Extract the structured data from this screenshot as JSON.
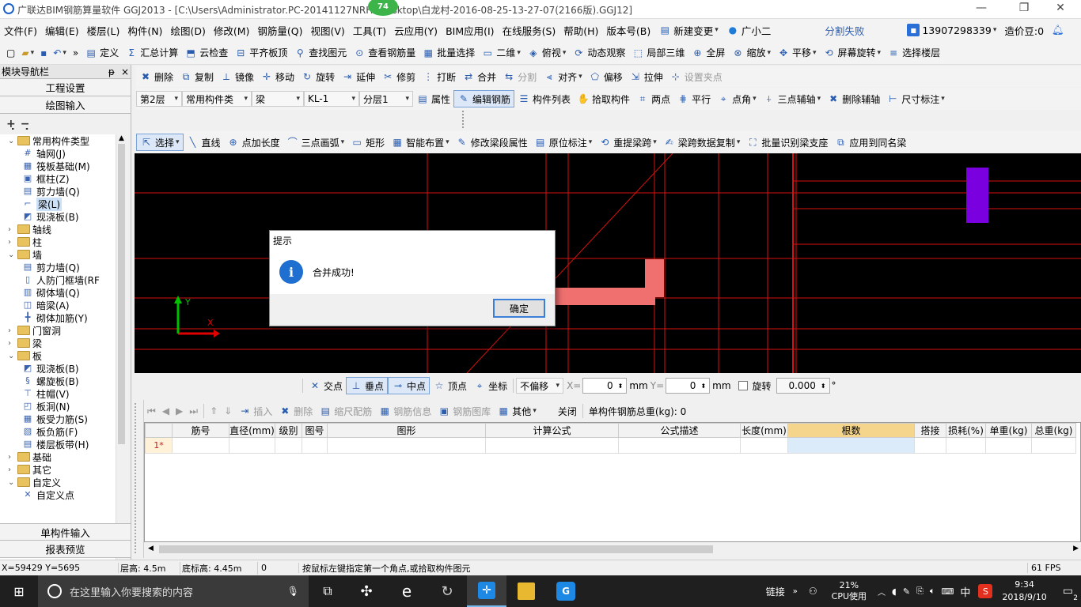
{
  "window": {
    "title": "广联达BIM钢筋算量软件 GGJ2013 - [C:\\Users\\Administrator.PC-20141127NRHI\\Desktop\\白龙村-2016-08-25-13-27-07(2166版).GGJ12]",
    "badge": "74",
    "minimize": "—",
    "restore": "❐",
    "close": "✕"
  },
  "menu": {
    "items": [
      "文件(F)",
      "编辑(E)",
      "楼层(L)",
      "构件(N)",
      "绘图(D)",
      "修改(M)",
      "钢筋量(Q)",
      "视图(V)",
      "工具(T)",
      "云应用(Y)",
      "BIM应用(I)",
      "在线服务(S)",
      "帮助(H)",
      "版本号(B)"
    ],
    "new_change": "新建变更",
    "assistant": "广小二",
    "split_status": "分割失败",
    "phone": "13907298339",
    "price": "造价豆:0"
  },
  "toolbar1": {
    "items": [
      "定义",
      "汇总计算",
      "云检查",
      "平齐板顶",
      "查找图元",
      "查看钢筋量",
      "批量选择",
      "二维",
      "俯视",
      "动态观察",
      "局部三维",
      "全屏",
      "缩放",
      "平移",
      "屏幕旋转",
      "选择楼层"
    ]
  },
  "toolbar2": {
    "items": [
      "删除",
      "复制",
      "镜像",
      "移动",
      "旋转",
      "延伸",
      "修剪",
      "打断",
      "合并",
      "分割",
      "对齐",
      "偏移",
      "拉伸",
      "设置夹点"
    ]
  },
  "toolbar3": {
    "floor": "第2层",
    "category": "常用构件类",
    "type": "梁",
    "name": "KL-1",
    "layer": "分层1",
    "items": [
      "属性",
      "编辑钢筋",
      "构件列表",
      "拾取构件",
      "两点",
      "平行",
      "点角",
      "三点辅轴",
      "删除辅轴",
      "尺寸标注"
    ]
  },
  "toolbar4": {
    "items": [
      "选择",
      "直线",
      "点加长度",
      "三点画弧",
      "矩形",
      "智能布置",
      "修改梁段属性",
      "原位标注",
      "重提梁跨",
      "梁跨数据复制",
      "批量识别梁支座",
      "应用到同名梁"
    ]
  },
  "nav": {
    "title": "模块导航栏",
    "pin": "ᵽ",
    "close": "×",
    "sections": [
      "工程设置",
      "绘图输入"
    ],
    "bottom_sections": [
      "单构件输入",
      "报表预览"
    ],
    "tree": [
      {
        "label": "常用构件类型",
        "level": 0,
        "kind": "folder",
        "exp": "⌄"
      },
      {
        "label": "轴网(J)",
        "level": 1,
        "kind": "comp",
        "icon": "#"
      },
      {
        "label": "筏板基础(M)",
        "level": 1,
        "kind": "comp",
        "icon": "▦"
      },
      {
        "label": "框柱(Z)",
        "level": 1,
        "kind": "comp",
        "icon": "▣"
      },
      {
        "label": "剪力墙(Q)",
        "level": 1,
        "kind": "comp",
        "icon": "▤"
      },
      {
        "label": "梁(L)",
        "level": 1,
        "kind": "comp",
        "icon": "⌐",
        "selected": true
      },
      {
        "label": "现浇板(B)",
        "level": 1,
        "kind": "comp",
        "icon": "◩"
      },
      {
        "label": "轴线",
        "level": 0,
        "kind": "folder",
        "exp": "›"
      },
      {
        "label": "柱",
        "level": 0,
        "kind": "folder",
        "exp": "›"
      },
      {
        "label": "墙",
        "level": 0,
        "kind": "folder",
        "exp": "⌄"
      },
      {
        "label": "剪力墙(Q)",
        "level": 1,
        "kind": "comp",
        "icon": "▤"
      },
      {
        "label": "人防门框墙(RF",
        "level": 1,
        "kind": "comp",
        "icon": "▯"
      },
      {
        "label": "砌体墙(Q)",
        "level": 1,
        "kind": "comp",
        "icon": "▥"
      },
      {
        "label": "暗梁(A)",
        "level": 1,
        "kind": "comp",
        "icon": "◫"
      },
      {
        "label": "砌体加筋(Y)",
        "level": 1,
        "kind": "comp",
        "icon": "╋"
      },
      {
        "label": "门窗洞",
        "level": 0,
        "kind": "folder",
        "exp": "›"
      },
      {
        "label": "梁",
        "level": 0,
        "kind": "folder",
        "exp": "›"
      },
      {
        "label": "板",
        "level": 0,
        "kind": "folder",
        "exp": "⌄"
      },
      {
        "label": "现浇板(B)",
        "level": 1,
        "kind": "comp",
        "icon": "◩"
      },
      {
        "label": "螺旋板(B)",
        "level": 1,
        "kind": "comp",
        "icon": "§"
      },
      {
        "label": "柱帽(V)",
        "level": 1,
        "kind": "comp",
        "icon": "⊤"
      },
      {
        "label": "板洞(N)",
        "level": 1,
        "kind": "comp",
        "icon": "◰"
      },
      {
        "label": "板受力筋(S)",
        "level": 1,
        "kind": "comp",
        "icon": "▦"
      },
      {
        "label": "板负筋(F)",
        "level": 1,
        "kind": "comp",
        "icon": "▧"
      },
      {
        "label": "楼层板带(H)",
        "level": 1,
        "kind": "comp",
        "icon": "▤"
      },
      {
        "label": "基础",
        "level": 0,
        "kind": "folder",
        "exp": "›"
      },
      {
        "label": "其它",
        "level": 0,
        "kind": "folder",
        "exp": "›"
      },
      {
        "label": "自定义",
        "level": 0,
        "kind": "folder",
        "exp": "⌄"
      },
      {
        "label": "自定义点",
        "level": 1,
        "kind": "comp",
        "icon": "✕"
      }
    ]
  },
  "dialog": {
    "title": "提示",
    "message": "合并成功!",
    "ok": "确定"
  },
  "snapbar": {
    "items": [
      "交点",
      "垂点",
      "中点",
      "顶点",
      "坐标"
    ],
    "offset": "不偏移",
    "x_label": "X=",
    "x_value": "0",
    "x_unit": "mm",
    "y_label": "Y=",
    "y_value": "0",
    "y_unit": "mm",
    "rotate_label": "旋转",
    "rotate_value": "0.000",
    "degree": "°"
  },
  "grid_toolbar": {
    "items": [
      "插入",
      "删除",
      "缩尺配筋",
      "钢筋信息",
      "钢筋图库",
      "其他",
      "关闭"
    ],
    "total": "单构件钢筋总重(kg): 0"
  },
  "grid": {
    "columns": [
      "筋号",
      "直径(mm)",
      "级别",
      "图号",
      "图形",
      "计算公式",
      "公式描述",
      "长度(mm)",
      "根数",
      "搭接",
      "损耗(%)",
      "单重(kg)",
      "总重(kg)"
    ],
    "row1": "1*"
  },
  "status": {
    "coords": "X=59429 Y=5695",
    "floor_height": "层高: 4.5m",
    "base_height": "底标高: 4.45m",
    "zero": "0",
    "hint": "按鼠标左键指定第一个角点,或拾取构件图元",
    "fps": "61 FPS"
  },
  "taskbar": {
    "search": "在这里输入你要搜索的内容",
    "link": "链接",
    "cpu_pct": "21%",
    "cpu_label": "CPU使用",
    "lang": "中",
    "time": "9:34",
    "date": "2018/9/10",
    "notif": "2"
  },
  "colors": {
    "canvas": "#000000",
    "axis": "#e00000",
    "beam": "#f07070",
    "column": "#7b00e0",
    "dialog_icon": "#1e6fcf"
  }
}
